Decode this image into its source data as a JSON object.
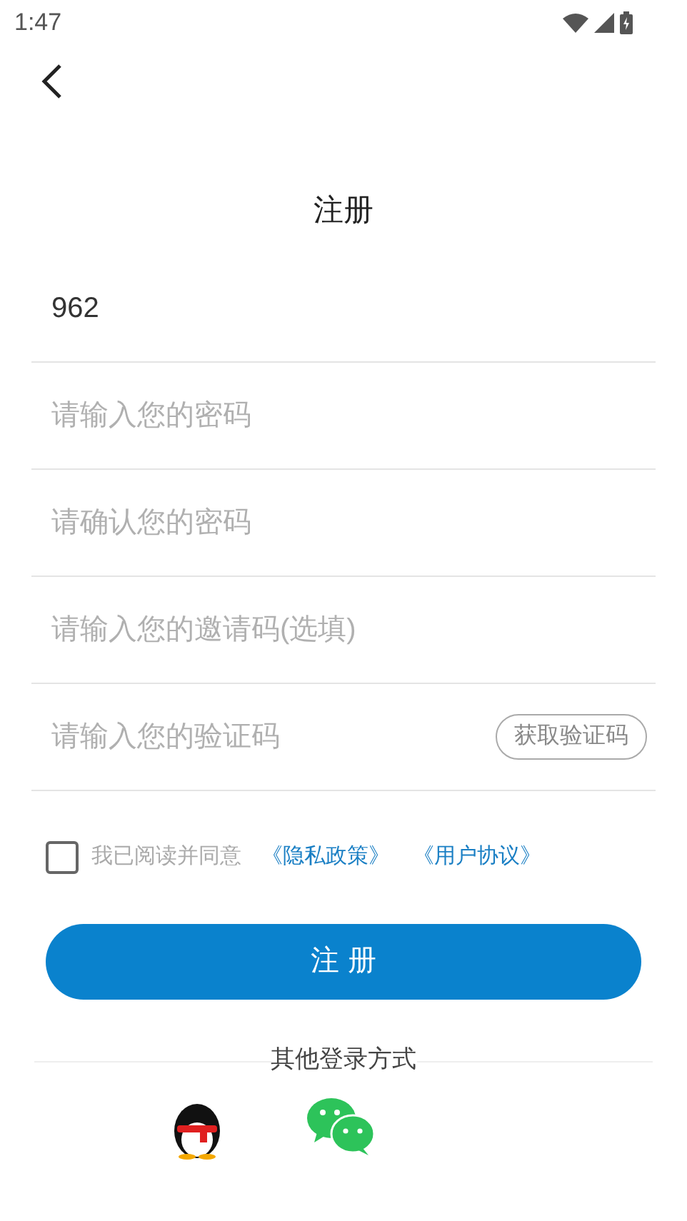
{
  "status_bar": {
    "time": "1:47"
  },
  "title": "注册",
  "fields": [
    {
      "kind": "text",
      "value": "962"
    },
    {
      "kind": "text",
      "placeholder": "请输入您的密码"
    },
    {
      "kind": "text",
      "placeholder": "请确认您的密码"
    },
    {
      "kind": "text",
      "placeholder": "请输入您的邀请码(选填)"
    },
    {
      "kind": "code",
      "placeholder": "请输入您的验证码",
      "button": "获取验证码"
    }
  ],
  "agreement": {
    "checked": false,
    "text": "我已阅读并同意",
    "links": [
      "《隐私政策》",
      "《用户协议》"
    ]
  },
  "submit": "注 册",
  "other_login": {
    "label": "其他登录方式",
    "options": [
      {
        "kind": "penguin"
      },
      {
        "kind": "chat"
      }
    ]
  }
}
